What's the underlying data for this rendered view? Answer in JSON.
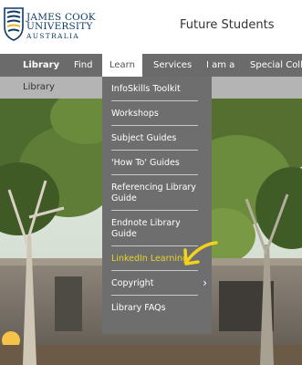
{
  "header": {
    "logo_lines": [
      "JAMES COOK",
      "UNIVERSITY",
      "AUSTRALIA"
    ],
    "site_title": "Future Students"
  },
  "nav": {
    "items": [
      {
        "label": "Library",
        "state": "active"
      },
      {
        "label": "Find",
        "state": "normal"
      },
      {
        "label": "Learn",
        "state": "open"
      },
      {
        "label": "Services",
        "state": "normal"
      },
      {
        "label": "I am a",
        "state": "normal"
      },
      {
        "label": "Special Colle",
        "state": "normal"
      }
    ]
  },
  "breadcrumb": "Library",
  "dropdown": {
    "items": [
      {
        "label": "InfoSkills Toolkit"
      },
      {
        "label": "Workshops"
      },
      {
        "label": "Subject Guides"
      },
      {
        "label": "'How To' Guides"
      },
      {
        "label": "Referencing Library Guide"
      },
      {
        "label": "Endnote Library Guide"
      },
      {
        "label": "LinkedIn Learning",
        "highlighted": true
      },
      {
        "label": "Copyright",
        "has_submenu": true
      },
      {
        "label": "Library FAQs"
      }
    ],
    "submenu_icon": "chevron-right-icon"
  },
  "colors": {
    "nav_bg": "#6b6b6b",
    "breadcrumb_bg": "#b4b4b4",
    "dropdown_bg": "#6e6e6e",
    "highlight_text": "#e6d32a",
    "annotation_arrow": "#f2d21b",
    "brand_blue": "#0d3b66"
  },
  "annotation": {
    "icon": "arrow-annotation-icon"
  }
}
